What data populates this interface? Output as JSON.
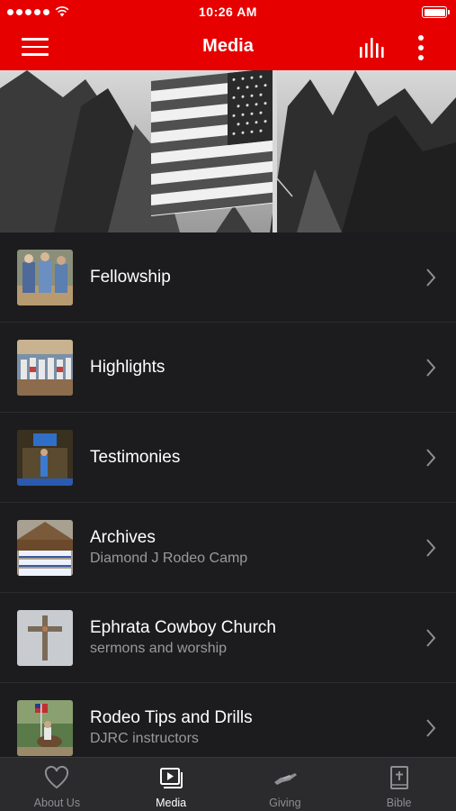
{
  "status_bar": {
    "time": "10:26 AM"
  },
  "header": {
    "title": "Media",
    "menu_icon": "hamburger-menu-icon",
    "bars_icon": "audio-bars-icon",
    "more_icon": "more-vertical-icon",
    "accent_color": "#e60000"
  },
  "hero": {
    "image": "american-flag-photo"
  },
  "list": {
    "items": [
      {
        "title": "Fellowship",
        "subtitle": "",
        "thumbnail": "fellowship-photo"
      },
      {
        "title": "Highlights",
        "subtitle": "",
        "thumbnail": "highlights-photo"
      },
      {
        "title": "Testimonies",
        "subtitle": "",
        "thumbnail": "testimonies-photo"
      },
      {
        "title": "Archives",
        "subtitle": "Diamond J Rodeo Camp",
        "thumbnail": "archives-photo"
      },
      {
        "title": "Ephrata Cowboy Church",
        "subtitle": "sermons and worship",
        "thumbnail": "cross-photo"
      },
      {
        "title": "Rodeo Tips and Drills",
        "subtitle": "DJRC instructors",
        "thumbnail": "rodeo-photo"
      }
    ]
  },
  "tab_bar": {
    "tabs": [
      {
        "label": "About Us",
        "icon": "heart-icon",
        "active": false
      },
      {
        "label": "Media",
        "icon": "media-player-icon",
        "active": true
      },
      {
        "label": "Giving",
        "icon": "giving-hand-icon",
        "active": false
      },
      {
        "label": "Bible",
        "icon": "bible-icon",
        "active": false
      }
    ]
  }
}
